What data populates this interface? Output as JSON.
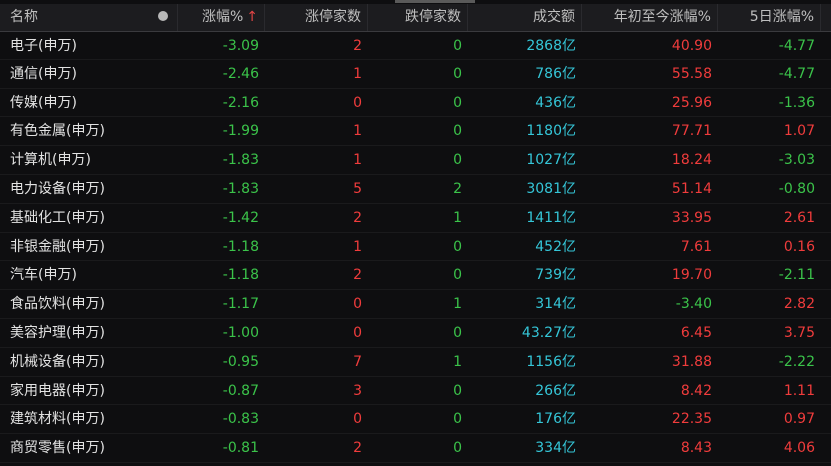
{
  "header": {
    "name": "名称",
    "change_pct": "涨幅%",
    "change_arrow": "↑",
    "limit_up": "涨停家数",
    "limit_down": "跌停家数",
    "turnover": "成交额",
    "ytd": "年初至今涨幅%",
    "five_day": "5日涨幅%"
  },
  "rows": [
    {
      "name": "电子(申万)",
      "change": "-3.09",
      "up": "2",
      "down": "0",
      "turnover": "2868亿",
      "ytd": "40.90",
      "five": "-4.77"
    },
    {
      "name": "通信(申万)",
      "change": "-2.46",
      "up": "1",
      "down": "0",
      "turnover": "786亿",
      "ytd": "55.58",
      "five": "-4.77"
    },
    {
      "name": "传媒(申万)",
      "change": "-2.16",
      "up": "0",
      "down": "0",
      "turnover": "436亿",
      "ytd": "25.96",
      "five": "-1.36"
    },
    {
      "name": "有色金属(申万)",
      "change": "-1.99",
      "up": "1",
      "down": "0",
      "turnover": "1180亿",
      "ytd": "77.71",
      "five": "1.07"
    },
    {
      "name": "计算机(申万)",
      "change": "-1.83",
      "up": "1",
      "down": "0",
      "turnover": "1027亿",
      "ytd": "18.24",
      "five": "-3.03"
    },
    {
      "name": "电力设备(申万)",
      "change": "-1.83",
      "up": "5",
      "down": "2",
      "turnover": "3081亿",
      "ytd": "51.14",
      "five": "-0.80"
    },
    {
      "name": "基础化工(申万)",
      "change": "-1.42",
      "up": "2",
      "down": "1",
      "turnover": "1411亿",
      "ytd": "33.95",
      "five": "2.61"
    },
    {
      "name": "非银金融(申万)",
      "change": "-1.18",
      "up": "1",
      "down": "0",
      "turnover": "452亿",
      "ytd": "7.61",
      "five": "0.16"
    },
    {
      "name": "汽车(申万)",
      "change": "-1.18",
      "up": "2",
      "down": "0",
      "turnover": "739亿",
      "ytd": "19.70",
      "five": "-2.11"
    },
    {
      "name": "食品饮料(申万)",
      "change": "-1.17",
      "up": "0",
      "down": "1",
      "turnover": "314亿",
      "ytd": "-3.40",
      "five": "2.82"
    },
    {
      "name": "美容护理(申万)",
      "change": "-1.00",
      "up": "0",
      "down": "0",
      "turnover": "43.27亿",
      "ytd": "6.45",
      "five": "3.75"
    },
    {
      "name": "机械设备(申万)",
      "change": "-0.95",
      "up": "7",
      "down": "1",
      "turnover": "1156亿",
      "ytd": "31.88",
      "five": "-2.22"
    },
    {
      "name": "家用电器(申万)",
      "change": "-0.87",
      "up": "3",
      "down": "0",
      "turnover": "266亿",
      "ytd": "8.42",
      "five": "1.11"
    },
    {
      "name": "建筑材料(申万)",
      "change": "-0.83",
      "up": "0",
      "down": "0",
      "turnover": "176亿",
      "ytd": "22.35",
      "five": "0.97"
    },
    {
      "name": "商贸零售(申万)",
      "change": "-0.81",
      "up": "2",
      "down": "0",
      "turnover": "334亿",
      "ytd": "8.43",
      "five": "4.06"
    }
  ],
  "colors": {
    "up": "#f03c3c",
    "down": "#3bc34a",
    "turnover": "#35c6d8"
  }
}
